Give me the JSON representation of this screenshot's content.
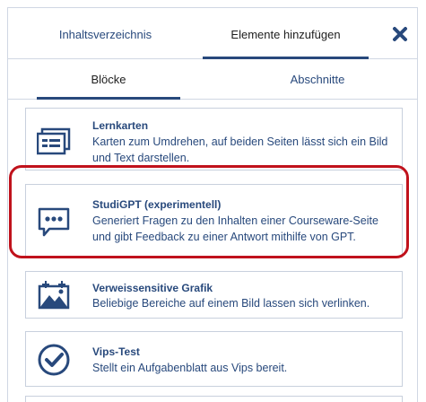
{
  "tabs": {
    "main": [
      "Inhaltsverzeichnis",
      "Elemente hinzufügen"
    ],
    "sub": [
      "Blöcke",
      "Abschnitte"
    ]
  },
  "close_icon": "close-icon",
  "accent_color": "#28497c",
  "highlight_color": "#c0121c",
  "blocks": [
    {
      "title": "Lernkarten",
      "desc": "Karten zum Umdrehen, auf beiden Seiten lässt sich ein Bild und Text darstellen.",
      "icon": "flashcards-icon"
    },
    {
      "title": "StudiGPT (experimentell)",
      "desc": "Generiert Fragen zu den Inhalten einer Courseware-Seite und gibt Feedback zu einer Antwort mithilfe von GPT.",
      "icon": "chat-bubble-icon"
    },
    {
      "title": "Verweissensitive Grafik",
      "desc": "Beliebige Bereiche auf einem Bild lassen sich verlinken.",
      "icon": "image-map-icon"
    },
    {
      "title": "Vips-Test",
      "desc": "Stellt ein Aufgabenblatt aus Vips bereit.",
      "icon": "check-circle-icon"
    }
  ]
}
